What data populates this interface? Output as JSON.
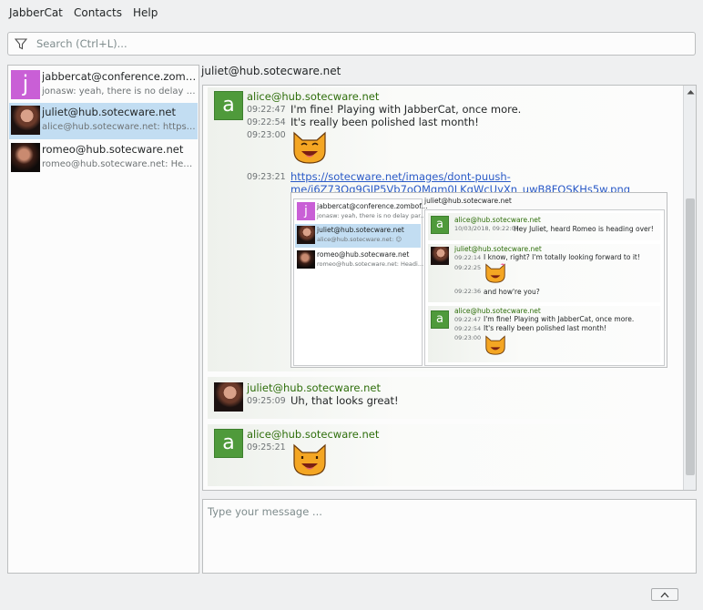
{
  "menu": [
    "JabberCat",
    "Contacts",
    "Help"
  ],
  "search": {
    "placeholder": "Search (Ctrl+L)..."
  },
  "roster": [
    {
      "avatar_letter": "j",
      "title": "jabbercat@conference.zombofant.net",
      "preview": "jonasw: yeah, there is no delay particularly"
    },
    {
      "title": "juliet@hub.sotecware.net",
      "preview": "alice@hub.sotecware.net: https://sotecware.net",
      "selected": true
    },
    {
      "title": "romeo@hub.sotecware.net",
      "preview": "romeo@hub.sotecware.net: Heading over"
    }
  ],
  "chat": {
    "title": "juliet@hub.sotecware.net",
    "messages": [
      {
        "sender": "alice@hub.sotecware.net",
        "avatar_letter": "a",
        "lines": [
          {
            "time": "09:22:47",
            "text": "I'm fine! Playing with JabberCat, once more."
          },
          {
            "time": "09:22:54",
            "text": "It's really been polished last month!"
          },
          {
            "time": "09:23:00",
            "text": ""
          },
          {
            "time": "09:23:21",
            "link_line1": "https://sotecware.net/images/dont-puush-",
            "link_line2": "me/i6Z73Oq9GIP5Vb7oQMgm0LKgWcUyXn_uwB8FQSKHs5w.png"
          }
        ]
      },
      {
        "sender": "juliet@hub.sotecware.net",
        "lines": [
          {
            "time": "09:25:09",
            "text": "Uh, that looks great!"
          }
        ]
      },
      {
        "sender": "alice@hub.sotecware.net",
        "avatar_letter": "a",
        "lines": [
          {
            "time": "09:25:21",
            "text": ""
          }
        ]
      }
    ]
  },
  "embed": {
    "roster": [
      {
        "letter": "j",
        "t1": "jabbercat@conference.zombof...",
        "t2": "jonasw: yeah, there is no delay par..."
      },
      {
        "t1": "juliet@hub.sotecware.net",
        "t2": "alice@hub.sotecware.net: ☺"
      },
      {
        "t1": "romeo@hub.sotecware.net",
        "t2": "romeo@hub.sotecware.net: Headi..."
      }
    ],
    "chat_title": "juliet@hub.sotecware.net",
    "m1_sender": "alice@hub.sotecware.net",
    "m1_time": "10/03/2018, 09:22:03",
    "m1_text": "Hey Juliet, heard Romeo is heading over!",
    "m2_sender": "juliet@hub.sotecware.net",
    "m2_time1": "09:22:14",
    "m2_text1": "I know, right? I'm totally looking forward to it!",
    "m2_time2": "09:22:25",
    "m2_time3": "09:22:36",
    "m2_text3": "and how're you?",
    "m3_sender": "alice@hub.sotecware.net",
    "m3_time1": "09:22:47",
    "m3_text1": "I'm fine! Playing with JabberCat, once more.",
    "m3_time2": "09:22:54",
    "m3_text2": "It's really been polished last month!",
    "m3_time3": "09:23:00"
  },
  "composer": {
    "placeholder": "Type your message ..."
  },
  "colors": {
    "selection": "#c2ddf2",
    "sender": "#2e6e0b",
    "link": "#2a5ac7",
    "avatar_j": "#c95fd6",
    "avatar_a": "#4f9a3b"
  },
  "icons": {
    "search": "filter-icon",
    "scroll_up": "chevron-up-icon",
    "toggle": "chevron-up-icon"
  }
}
